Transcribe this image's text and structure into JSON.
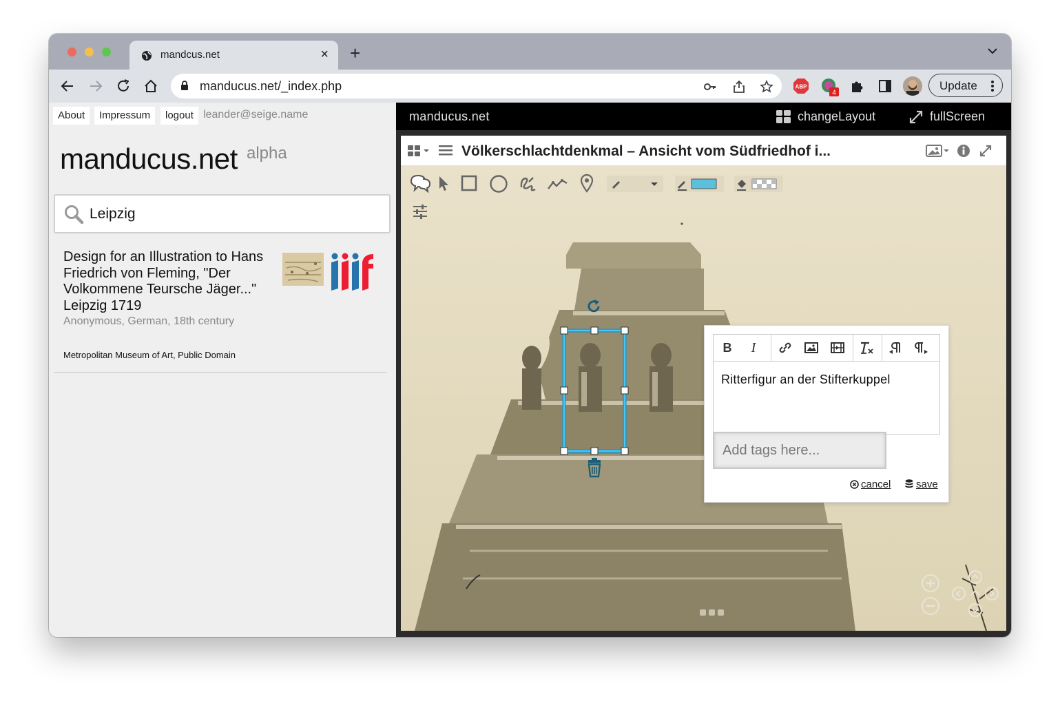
{
  "browser": {
    "tab_title": "mandcus.net",
    "url": "manducus.net/_index.php",
    "update_label": "Update",
    "extension_badge": "4",
    "abp_label": "ABP"
  },
  "left": {
    "nav": [
      "About",
      "Impressum",
      "logout"
    ],
    "user_email": "leander@seige.name",
    "logo": "manducus.net",
    "logo_sup": "alpha",
    "search_value": "Leipzig",
    "result": {
      "title": "Design for an Illustration to Hans Friedrich von Fleming, \"Der Volkommene Teursche Jäger...\" Leipzig 1719",
      "subtitle": "Anonymous, German, 18th century",
      "credit": "Metropolitan Museum of Art, Public Domain"
    }
  },
  "viewer": {
    "brand": "manducus.net",
    "change_layout": "changeLayout",
    "fullscreen": "fullScreen",
    "title": "Völkerschlachtdenkmal – Ansicht vom Südfriedhof i...",
    "annotation": {
      "text": "Ritterfigur an der Stifterkuppel",
      "tags_placeholder": "Add tags here...",
      "cancel": "cancel",
      "save": "save"
    },
    "stroke_color": "#5bc0de"
  }
}
